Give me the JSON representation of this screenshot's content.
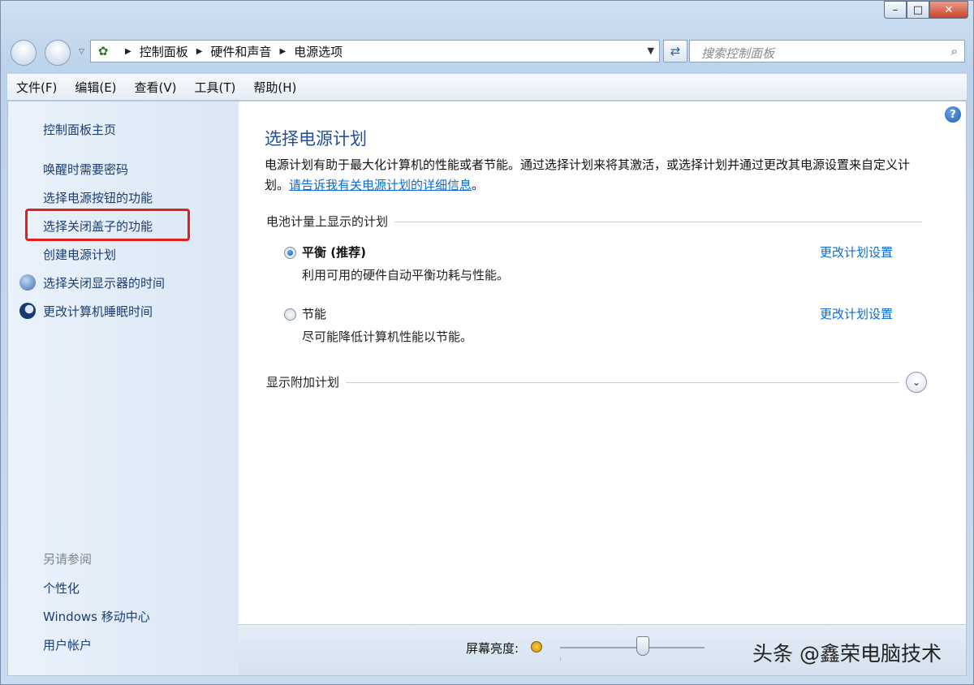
{
  "window": {
    "controls": {
      "minimize": "–",
      "maximize": "□",
      "close": "✕"
    }
  },
  "address": {
    "crumbs": [
      "控制面板",
      "硬件和声音",
      "电源选项"
    ],
    "search_placeholder": "搜索控制面板"
  },
  "menu": [
    "文件(F)",
    "编辑(E)",
    "查看(V)",
    "工具(T)",
    "帮助(H)"
  ],
  "sidebar": {
    "home": "控制面板主页",
    "items": [
      "唤醒时需要密码",
      "选择电源按钮的功能",
      "选择关闭盖子的功能",
      "创建电源计划",
      "选择关闭显示器的时间",
      "更改计算机睡眠时间"
    ],
    "see_also_title": "另请参阅",
    "see_also": [
      "个性化",
      "Windows 移动中心",
      "用户帐户"
    ]
  },
  "main": {
    "title": "选择电源计划",
    "description": "电源计划有助于最大化计算机的性能或者节能。通过选择计划来将其激活，或选择计划并通过更改其电源设置来自定义计划。",
    "learn_more": "请告诉我有关电源计划的详细信息",
    "battery_group": "电池计量上显示的计划",
    "plans": [
      {
        "name": "平衡 (推荐)",
        "desc": "利用可用的硬件自动平衡功耗与性能。",
        "link": "更改计划设置",
        "selected": true
      },
      {
        "name": "节能",
        "desc": "尽可能降低计算机性能以节能。",
        "link": "更改计划设置",
        "selected": false
      }
    ],
    "more_plans": "显示附加计划"
  },
  "bottom": {
    "brightness_label": "屏幕亮度:",
    "watermark": "头条 @鑫荣电脑技术"
  }
}
